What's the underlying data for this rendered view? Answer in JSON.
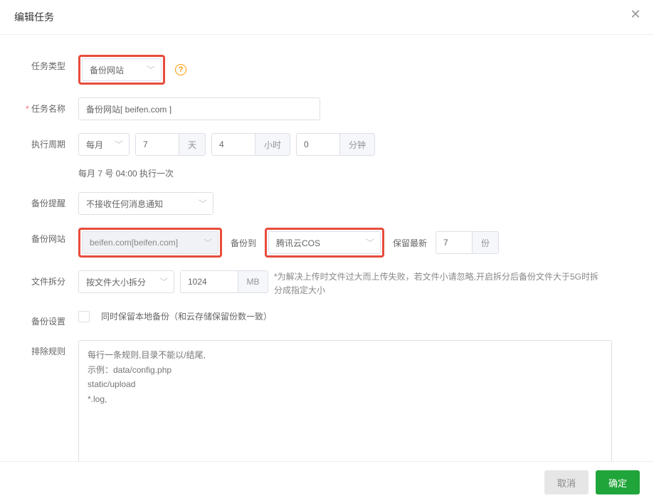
{
  "header": {
    "title": "编辑任务"
  },
  "form": {
    "taskType": {
      "label": "任务类型",
      "value": "备份网站"
    },
    "taskName": {
      "label": "任务名称",
      "value": "备份网站[ beifen.com ]"
    },
    "cycle": {
      "label": "执行周期",
      "mode": "每月",
      "day": "7",
      "dayUnit": "天",
      "hour": "4",
      "hourUnit": "小时",
      "minute": "0",
      "minuteUnit": "分钟",
      "hint": "每月 7 号 04:00 执行一次"
    },
    "notify": {
      "label": "备份提醒",
      "value": "不接收任何消息通知"
    },
    "site": {
      "label": "备份网站",
      "value": "beifen.com[beifen.com]",
      "toLabel": "备份到",
      "toValue": "腾讯云COS",
      "keepLabel": "保留最新",
      "keepValue": "7",
      "keepUnit": "份"
    },
    "split": {
      "label": "文件拆分",
      "mode": "按文件大小拆分",
      "size": "1024",
      "unit": "MB",
      "note": "*为解决上传时文件过大而上传失败，若文件小请忽略,开启拆分后备份文件大于5G时拆分成指定大小"
    },
    "settings": {
      "label": "备份设置",
      "checkboxLabel": "同时保留本地备份（和云存储保留份数一致）"
    },
    "exclude": {
      "label": "排除规则",
      "placeholder": "每行一条规则,目录不能以/结尾,\n示例：data/config.php\nstatic/upload\n*.log,"
    }
  },
  "footer": {
    "cancel": "取消",
    "confirm": "确定"
  },
  "icons": {
    "help": "?",
    "close": "✕"
  }
}
